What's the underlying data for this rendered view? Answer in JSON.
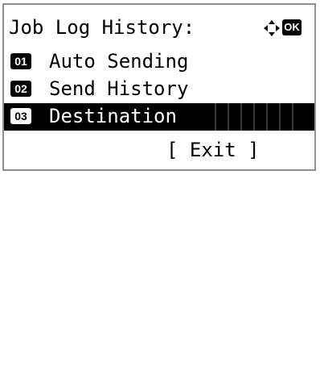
{
  "header": {
    "title": "Job Log History:",
    "nav_icon": "four-way-arrow-icon",
    "ok_label": "OK"
  },
  "menu": {
    "items": [
      {
        "number": "01",
        "label": "Auto Sending",
        "selected": false
      },
      {
        "number": "02",
        "label": "Send History",
        "selected": false
      },
      {
        "number": "03",
        "label": "Destination",
        "selected": true
      }
    ]
  },
  "footer": {
    "exit_label": "[ Exit ]"
  },
  "colors": {
    "background": "#ffffff",
    "text": "#000000",
    "selection": "#000000",
    "border": "#8f8f8f"
  }
}
